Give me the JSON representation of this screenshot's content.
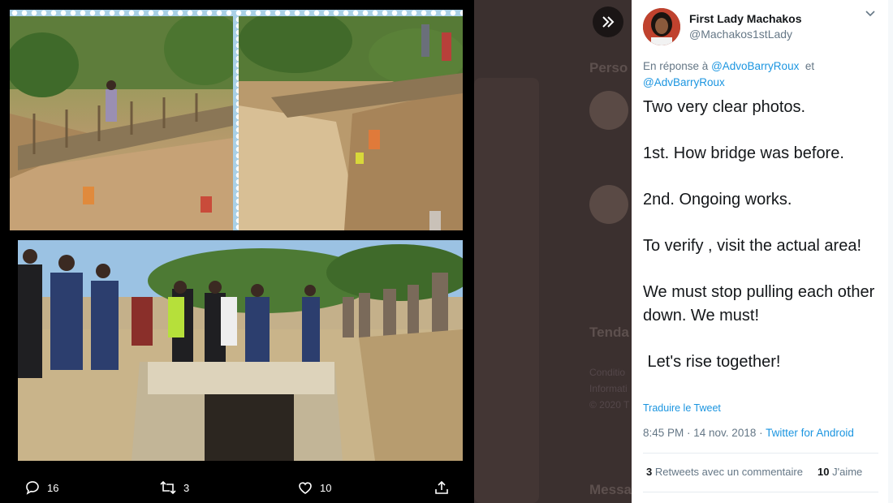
{
  "background_page": {
    "label_people": "Perso",
    "label_trends": "Tenda",
    "label_messages": "Messa",
    "small_1": "Conditio",
    "small_2": "Informati",
    "small_3": "© 2020 T"
  },
  "media_viewer": {
    "expand_icon": "double-chevron-right-icon",
    "actions": {
      "reply_count": "16",
      "retweet_count": "3",
      "like_count": "10"
    }
  },
  "tweet": {
    "author_name": "First Lady Machakos",
    "author_handle": "@Machakos1stLady",
    "reply_prefix": "En réponse à",
    "reply_to_1": "@AdvoBarryRoux",
    "reply_join": "et",
    "reply_to_2": "@AdvBarryRoux",
    "body": [
      "Two very clear photos.",
      "1st. How bridge was before.",
      "2nd. Ongoing works.",
      "To verify , visit the actual area!",
      "We must stop pulling each other down. We must!",
      " Let's rise together!"
    ],
    "translate_label": "Traduire le Tweet",
    "time": "8:45 PM · 14 nov. 2018 ·",
    "source": "Twitter for Android",
    "retweets_count": "3",
    "retweets_label": "Retweets avec un commentaire",
    "likes_count": "10",
    "likes_label": "J'aime"
  }
}
